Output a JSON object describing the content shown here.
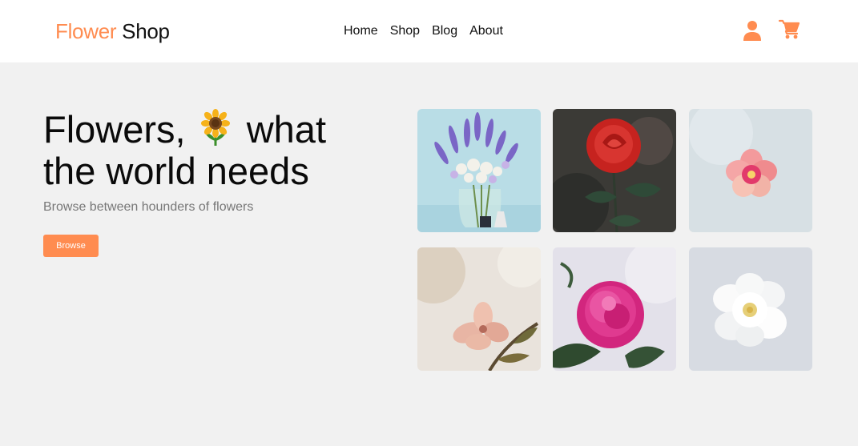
{
  "brand": {
    "word1": "Flower",
    "word2": "Shop"
  },
  "nav": {
    "links": [
      {
        "label": "Home"
      },
      {
        "label": "Shop"
      },
      {
        "label": "Blog"
      },
      {
        "label": "About"
      }
    ]
  },
  "icons": {
    "account": "user-icon",
    "cart": "cart-icon"
  },
  "hero": {
    "title_part1": "Flowers,",
    "title_part2": "what the world needs",
    "emoji": "sunflower-icon",
    "subtitle": "Browse between hounders of flowers",
    "button_label": "Browse"
  },
  "gallery": {
    "images": [
      {
        "name": "lavender-bouquet-image"
      },
      {
        "name": "red-rose-image"
      },
      {
        "name": "pink-flower-image"
      },
      {
        "name": "peach-blossom-image"
      },
      {
        "name": "pink-peony-image"
      },
      {
        "name": "white-rose-image"
      }
    ]
  },
  "colors": {
    "accent": "#ff8c50",
    "background": "#f1f1f1",
    "navbar": "#ffffff"
  }
}
